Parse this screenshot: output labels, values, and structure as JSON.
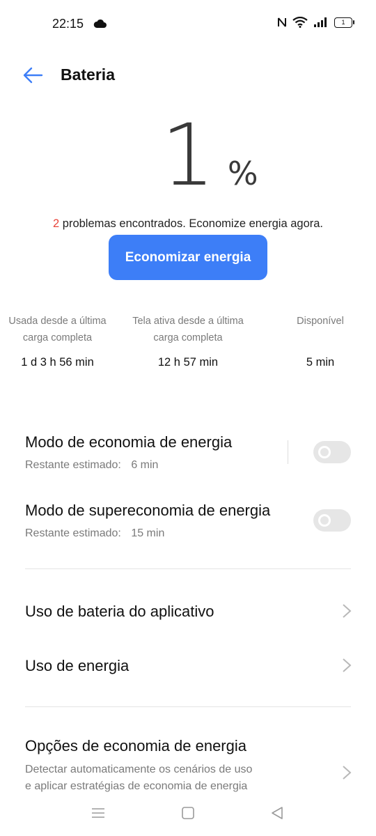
{
  "status_bar": {
    "time": "22:15",
    "battery_level": "1",
    "icons": [
      "cloud-icon",
      "nfc-icon",
      "wifi-icon",
      "signal-icon",
      "battery-icon"
    ]
  },
  "header": {
    "title": "Bateria",
    "back_icon": "arrow-left-icon"
  },
  "battery": {
    "value": "1",
    "unit": "%",
    "problems_count": "2",
    "problems_text": " problemas encontrados. Economize energia agora.",
    "save_button": "Economizar energia"
  },
  "stats": [
    {
      "label_line1": "Usada desde a última",
      "label_line2": "carga completa",
      "value": "1 d 3 h 56 min"
    },
    {
      "label_line1": "Tela ativa desde a última",
      "label_line2": "carga completa",
      "value": "12 h 57 min"
    },
    {
      "label_line1": "Disponível",
      "label_line2": "",
      "value": "5 min"
    }
  ],
  "modes": [
    {
      "title": "Modo de economia de energia",
      "sub_label": "Restante estimado:",
      "sub_value": "6 min",
      "enabled": false
    },
    {
      "title": "Modo de supereconomia de energia",
      "sub_label": "Restante estimado:",
      "sub_value": "15 min",
      "enabled": false
    }
  ],
  "links": [
    {
      "title": "Uso de bateria do aplicativo"
    },
    {
      "title": "Uso de energia"
    }
  ],
  "options": {
    "title": "Opções de economia de energia",
    "desc_line1": "Detectar automaticamente os cenários de uso",
    "desc_line2": "e aplicar estratégias de economia de energia"
  },
  "colors": {
    "accent": "#3d7ef7",
    "problem_count": "#e8443a",
    "toggle_off": "#e6e6e6"
  }
}
